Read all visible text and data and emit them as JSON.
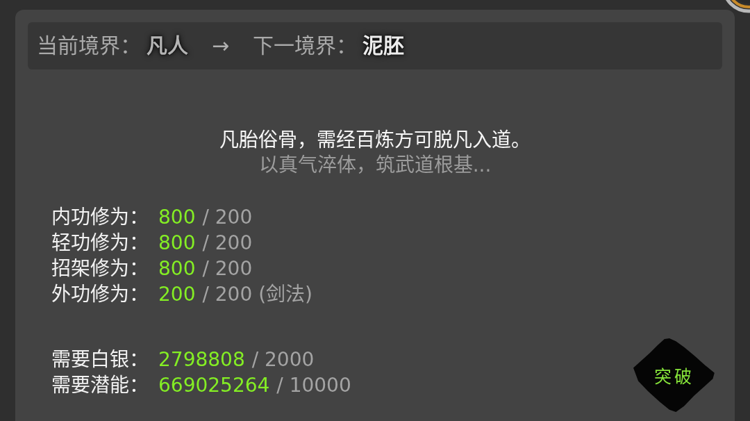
{
  "header": {
    "current_label": "当前境界：",
    "current_realm": "凡人",
    "arrow": "→",
    "next_label": "下一境界：",
    "next_realm": "泥胚"
  },
  "description": {
    "motto": "凡胎俗骨，需经百炼方可脱凡入道。",
    "hint": "以真气淬体，筑武道根基..."
  },
  "cultivation": [
    {
      "label": "内功修为：",
      "value": "800",
      "requirement": "/ 200"
    },
    {
      "label": "轻功修为：",
      "value": "800",
      "requirement": "/ 200"
    },
    {
      "label": "招架修为：",
      "value": "800",
      "requirement": "/ 200"
    },
    {
      "label": "外功修为：",
      "value": "200",
      "requirement": "/ 200 (剑法)"
    }
  ],
  "costs": [
    {
      "label": "需要白银：",
      "value": "2798808",
      "requirement": "/ 2000"
    },
    {
      "label": "需要潜能：",
      "value": "669025264",
      "requirement": "/ 10000"
    }
  ],
  "breakthrough_button": {
    "label": "突破"
  }
}
